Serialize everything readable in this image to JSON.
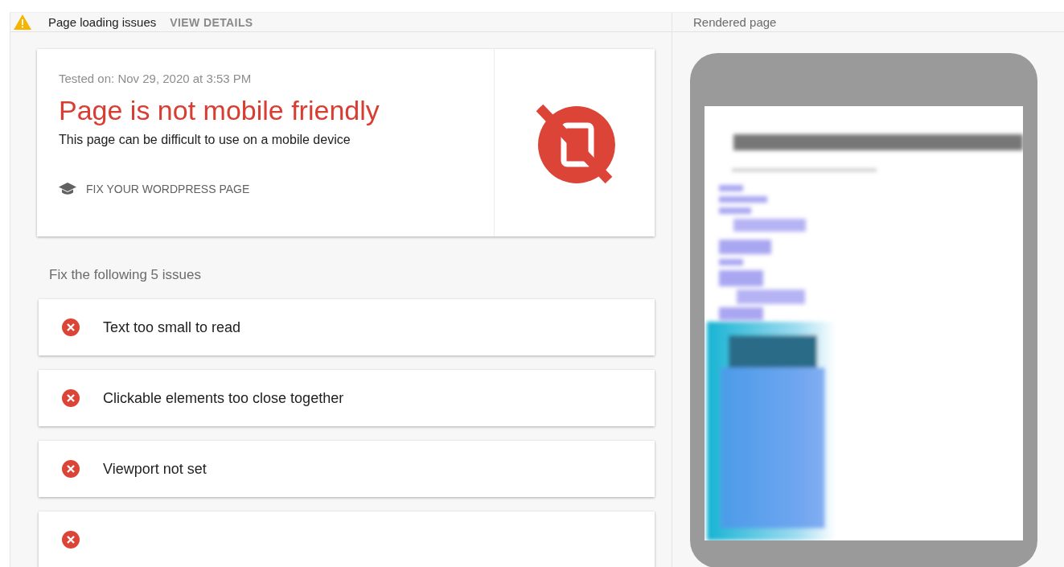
{
  "header": {
    "warning": "Page loading issues",
    "action": "VIEW DETAILS",
    "right_title": "Rendered page"
  },
  "result": {
    "tested_on": "Tested on: Nov 29, 2020 at 3:53 PM",
    "title": "Page is not mobile friendly",
    "description": "This page can be difficult to use on a mobile device",
    "link": "FIX YOUR WORDPRESS PAGE"
  },
  "issues_heading": "Fix the following 5 issues",
  "issues": [
    {
      "kind": "error",
      "label": "Text too small to read"
    },
    {
      "kind": "error",
      "label": "Clickable elements too close together"
    },
    {
      "kind": "error",
      "label": "Viewport not set"
    },
    {
      "kind": "error"
    }
  ]
}
